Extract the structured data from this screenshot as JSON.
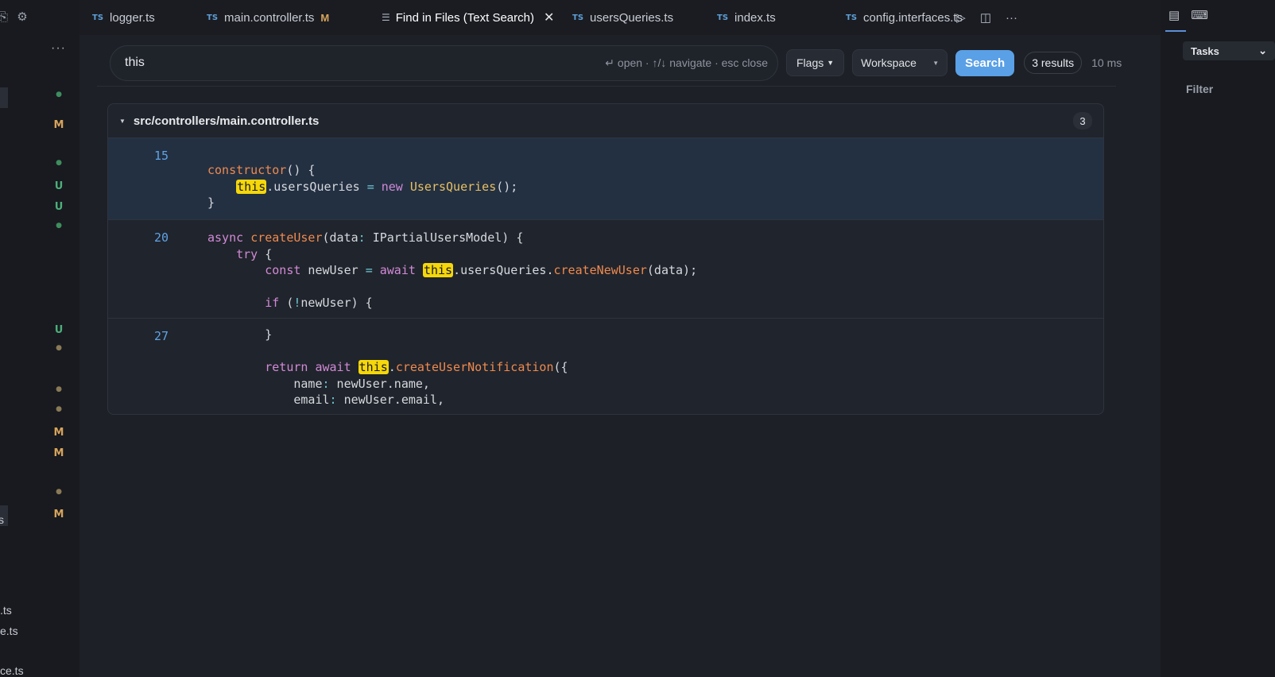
{
  "tabs": [
    {
      "label": "logger.ts",
      "type": "TS",
      "active": false
    },
    {
      "label": "main.controller.ts",
      "type": "TS",
      "modified": "M",
      "active": false
    },
    {
      "label": "Find in Files (Text Search)",
      "active": true
    },
    {
      "label": "usersQueries.ts",
      "type": "TS",
      "active": false
    },
    {
      "label": "index.ts",
      "type": "TS",
      "active": false
    },
    {
      "label": "config.interfaces.ts",
      "type": "TS",
      "active": false
    }
  ],
  "sidebar": {
    "badges": [
      {
        "text": "●",
        "color": "#3e8e5e"
      },
      {
        "text": "M",
        "color": "#d7a45c"
      },
      {
        "text": "●",
        "color": "#3e8e5e"
      },
      {
        "text": "U",
        "color": "#4caf7a"
      },
      {
        "text": "U",
        "color": "#4caf7a"
      },
      {
        "text": "●",
        "color": "#3e8e5e"
      },
      {
        "text": "U",
        "color": "#4caf7a"
      },
      {
        "text": "●",
        "color": "#8a7a55"
      },
      {
        "text": "●",
        "color": "#8a7a55"
      },
      {
        "text": "●",
        "color": "#8a7a55"
      },
      {
        "text": "M",
        "color": "#d7a45c"
      },
      {
        "text": "M",
        "color": "#d7a45c"
      },
      {
        "text": "●",
        "color": "#8a7a55"
      },
      {
        "text": "M",
        "color": "#d7a45c"
      }
    ],
    "fragments": [
      "s",
      ".ts",
      "e.ts",
      "ce.ts"
    ]
  },
  "search": {
    "query": "this",
    "hint": "↵ open · ↑/↓ navigate · esc close",
    "flags_label": "Flags",
    "scope_label": "Workspace",
    "search_button": "Search",
    "results_count": "3 results",
    "time": "10 ms"
  },
  "result": {
    "file_path": "src/controllers/main.controller.ts",
    "match_count": "3",
    "hunks": [
      {
        "line": "15"
      },
      {
        "line": "20"
      },
      {
        "line": "27"
      }
    ]
  },
  "right_panel": {
    "tasks_label": "Tasks",
    "filter_label": "Filter"
  },
  "colors": {
    "accent": "#5aa0e6",
    "highlight": "#f5d70b",
    "modified": "#d7a45c",
    "untracked": "#4caf7a"
  }
}
